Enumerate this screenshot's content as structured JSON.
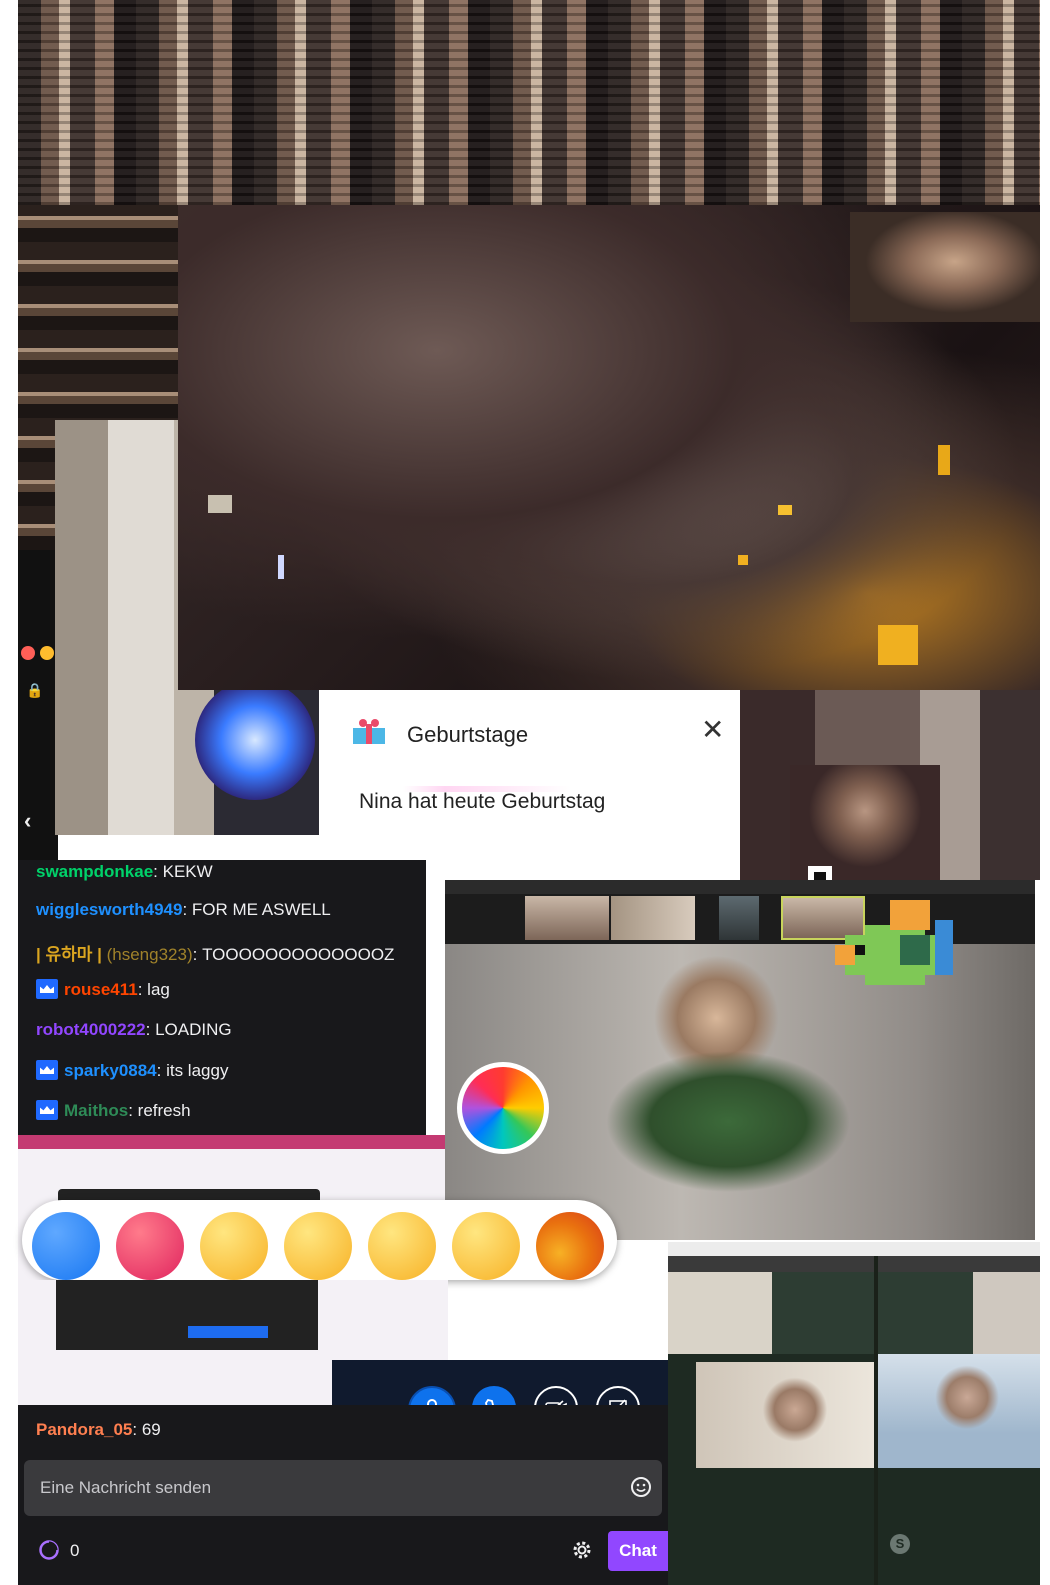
{
  "popup": {
    "title": "Geburtstage",
    "message": "Nina hat heute Geburtstag"
  },
  "chat": {
    "messages": [
      {
        "user": "swampdonkae",
        "text": ": KEKW",
        "color": "#00d26a",
        "badge": false
      },
      {
        "user": "wigglesworth4949",
        "text": ": FOR ME ASWELL",
        "color": "#1e90ff",
        "badge": false
      },
      {
        "user": "| 유하마 |",
        "user2": " (hseng323)",
        "text": ": TOOOOOOOOOOOOOZ",
        "color": "#daa520",
        "badge": false
      },
      {
        "user": "rouse411",
        "text": ": lag",
        "color": "#ff4500",
        "badge": true
      },
      {
        "user": "robot4000222",
        "text": ": LOADING",
        "color": "#9146ff",
        "badge": false
      },
      {
        "user": "sparky0884",
        "text": ": its laggy",
        "color": "#1e90ff",
        "badge": true
      },
      {
        "user": "Maithos",
        "text": ": refresh",
        "color": "#2e8b57",
        "badge": true
      }
    ],
    "last_message": {
      "user": "Pandora_05",
      "text": ": 69",
      "color": "#ff7f50"
    },
    "input_placeholder": "Eine Nachricht senden",
    "points": "0",
    "chat_button": "Chat"
  },
  "colors": {
    "twitch_purple": "#9147ff",
    "zoom_blue": "#0e72ed",
    "popup_close": "#333333"
  },
  "icons": [
    "gift-icon",
    "close-icon",
    "emoji-icon",
    "settings-icon",
    "channel-points-icon",
    "mic-icon",
    "phone-icon",
    "camera-off-icon",
    "screen-share-off-icon",
    "lock-icon",
    "back-chevron-icon",
    "spinning-wheel-icon",
    "skype-icon",
    "pixel-fish-icon"
  ],
  "reactions": [
    "like",
    "love",
    "care",
    "haha",
    "wow",
    "sad",
    "angry"
  ]
}
